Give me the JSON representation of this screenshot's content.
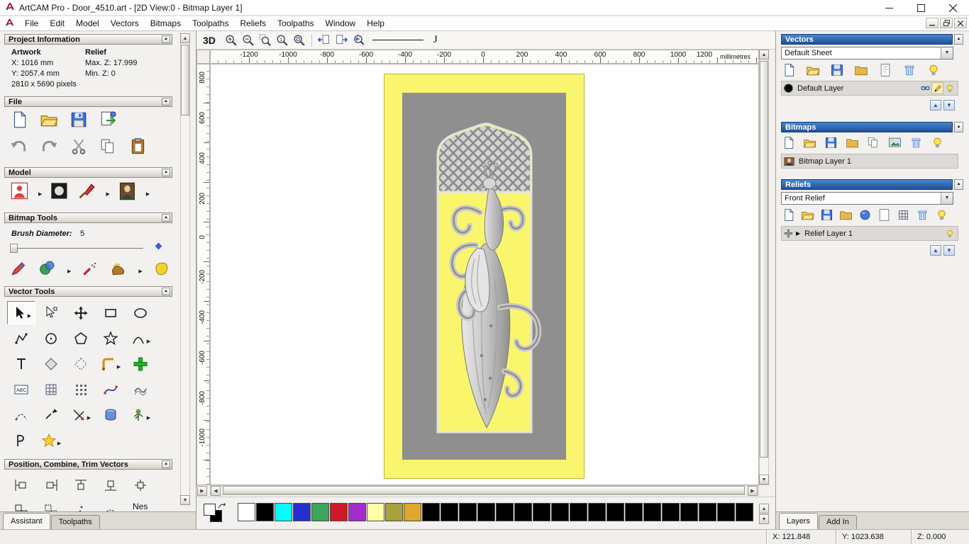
{
  "titlebar": {
    "title": "ArtCAM Pro - Door_4510.art - [2D View:0 - Bitmap Layer 1]",
    "window_buttons": [
      "minimize-icon",
      "maximize-icon",
      "close-icon"
    ]
  },
  "menubar": {
    "items": [
      "File",
      "Edit",
      "Model",
      "Vectors",
      "Bitmaps",
      "Toolpaths",
      "Reliefs",
      "Toolpaths",
      "Window",
      "Help"
    ]
  },
  "assistant": {
    "project_information": {
      "title": "Project Information",
      "artwork_heading": "Artwork",
      "relief_heading": "Relief",
      "artwork_x": "X: 1016 mm",
      "artwork_y": "Y: 2057.4 mm",
      "artwork_pixels": "2810 x 5690 pixels",
      "relief_max_z": "Max. Z: 17.999",
      "relief_min_z": "Min. Z: 0"
    },
    "file_section_title": "File",
    "file_icons": [
      "new-model-icon",
      "open-model-icon",
      "save-model-icon",
      "import-model-icon",
      "undo-icon",
      "redo-icon",
      "cut-icon",
      "copy-icon",
      "paste-icon"
    ],
    "model_section_title": "Model",
    "model_icons": [
      "set-model-size-icon",
      "invert-model-icon",
      "smooth-model-icon",
      "greyscale-image-icon"
    ],
    "bitmap_tools_title": "Bitmap Tools",
    "brush_diameter_label": "Brush Diameter:",
    "brush_diameter_value": "5",
    "bitmap_icons": [
      "paint-icon",
      "paint-selective-icon",
      "draw-icon",
      "flood-fill-icon",
      "flood-fill-region-icon"
    ],
    "vector_tools_title": "Vector Tools",
    "vector_tool_icons": [
      "select-vectors-icon",
      "node-editing-icon",
      "transform-vectors-icon",
      "create-rectangle-icon",
      "create-ellipse-icon",
      "create-polyline-icon",
      "create-circle-icon",
      "create-polygon-icon",
      "create-star-icon",
      "create-arc-icon",
      "create-text-icon",
      "offset-vectors-icon",
      "dotted-offset-icon",
      "fillet-icon",
      "paste-vector-icon",
      "text-block-icon",
      "grid-icon",
      "block-copy-icon",
      "fit-curve-icon",
      "free-polyline-icon",
      "arc-editing-icon",
      "join-vectors-icon",
      "trim-vectors-icon",
      "extrude-icon",
      "distort-icon",
      "profile-icon",
      "star-wizard-icon"
    ],
    "position_section_title": "Position, Combine, Trim Vectors",
    "nesting_abbrev": "Nes",
    "tabs": [
      "Assistant",
      "Toolpaths"
    ]
  },
  "canvas": {
    "toolbar_3d_label": "3D",
    "toolbar_icons": [
      "zoom-in-icon",
      "zoom-out-icon",
      "zoom-window-icon",
      "zoom-1to1-icon",
      "zoom-objects-icon",
      "pan-left-icon",
      "pan-right-icon",
      "zoom-previous-icon",
      "line-style-sample",
      "curve-style-sample"
    ],
    "h_ruler": {
      "ticks": [
        "-1200",
        "-1000",
        "-800",
        "-600",
        "-400",
        "-200",
        "0",
        "200",
        "400",
        "600",
        "800",
        "1000",
        "1200"
      ],
      "unit": "millimetres"
    },
    "v_ruler": {
      "ticks": [
        "800",
        "600",
        "400",
        "200",
        "0",
        "-200",
        "-400",
        "-600",
        "-800",
        "-1000"
      ]
    },
    "palette": {
      "colors": [
        "#ffffff",
        "#000000",
        "#00ffff",
        "#2431cf",
        "#3ba55c",
        "#cf1828",
        "#a42ccc",
        "#ffffa6",
        "#a8a23c",
        "#e0a72e",
        "#000000",
        "#000000",
        "#000000",
        "#000000",
        "#000000",
        "#000000",
        "#000000",
        "#000000",
        "#000000",
        "#000000",
        "#000000",
        "#000000",
        "#000000",
        "#000000",
        "#000000",
        "#000000",
        "#000000",
        "#000000"
      ],
      "primary": "#ffffff",
      "secondary": "#000000"
    }
  },
  "layers_panel": {
    "vectors": {
      "title": "Vectors",
      "sheet": "Default Sheet",
      "layer_name": "Default Layer",
      "layer_color": "#000000",
      "toolbar_icons": [
        "new-layer-icon",
        "open-icon",
        "save-icon",
        "import-icon",
        "new-sheet-icon",
        "delete-icon",
        "visibility-bulb-icon"
      ]
    },
    "bitmaps": {
      "title": "Bitmaps",
      "layer_name": "Bitmap Layer 1",
      "toolbar_icons": [
        "new-layer-icon",
        "open-icon",
        "save-icon",
        "import-icon",
        "copy-icon",
        "image-icon",
        "delete-icon",
        "visibility-bulb-icon"
      ]
    },
    "reliefs": {
      "title": "Reliefs",
      "selected": "Front Relief",
      "layer_name": "Relief Layer 1",
      "toolbar_icons": [
        "new-layer-icon",
        "open-icon",
        "save-icon",
        "import-icon",
        "sphere-icon",
        "blank-icon",
        "grid-icon",
        "delete-icon",
        "visibility-bulb-icon"
      ]
    },
    "tabs": [
      "Layers",
      "Add In"
    ]
  },
  "statusbar": {
    "x": "X: 121.848",
    "y": "Y: 1023.638",
    "z": "Z: 0.000"
  },
  "colors": {
    "header_blue": "#1d4f9a",
    "door_yellow": "#f9f66e"
  }
}
